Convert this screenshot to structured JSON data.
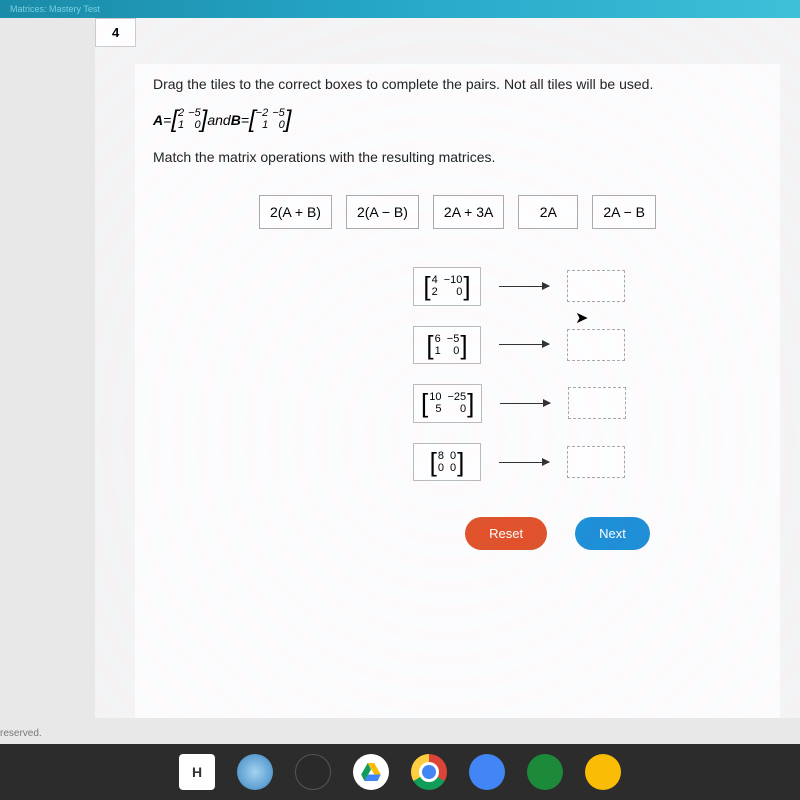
{
  "top_bar": {
    "breadcrumb": "Matrices: Mastery Test"
  },
  "tab_number": "4",
  "instruction1": "Drag the tiles to the correct boxes to complete the pairs. Not all tiles will be used.",
  "eq": {
    "A_label": "A",
    "equals1": "=",
    "A_matrix": [
      [
        "2",
        "−5"
      ],
      [
        "1",
        "0"
      ]
    ],
    "and": " and ",
    "B_label": "B",
    "equals2": "=",
    "B_matrix": [
      [
        "−2",
        "−5"
      ],
      [
        "1",
        "0"
      ]
    ]
  },
  "instruction2": "Match the matrix operations with the resulting matrices.",
  "tiles": [
    "2(A + B)",
    "2(A − B)",
    "2A + 3A",
    "2A",
    "2A − B"
  ],
  "results": [
    [
      [
        "4",
        "−10"
      ],
      [
        "2",
        "0"
      ]
    ],
    [
      [
        "6",
        "−5"
      ],
      [
        "1",
        "0"
      ]
    ],
    [
      [
        "10",
        "−25"
      ],
      [
        "5",
        "0"
      ]
    ],
    [
      [
        "8",
        "0"
      ],
      [
        "0",
        "0"
      ]
    ]
  ],
  "buttons": {
    "reset": "Reset",
    "next": "Next"
  },
  "footer": "reserved.",
  "taskbar": {
    "H": "H"
  }
}
